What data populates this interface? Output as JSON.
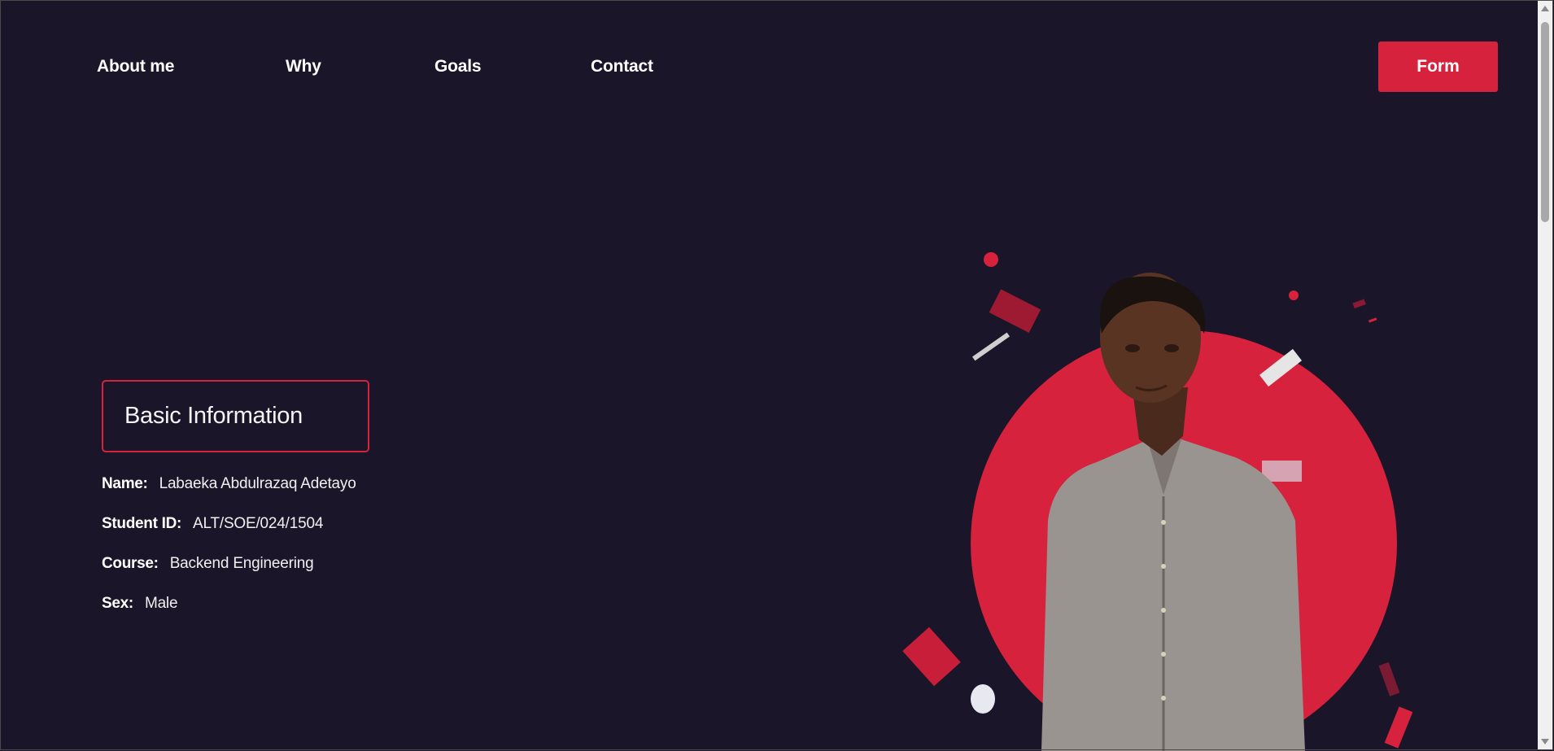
{
  "nav": {
    "links": [
      {
        "label": "About me"
      },
      {
        "label": "Why"
      },
      {
        "label": "Goals"
      },
      {
        "label": "Contact"
      }
    ],
    "form_button": "Form"
  },
  "basic_info": {
    "title": "Basic Information",
    "rows": [
      {
        "label": "Name:",
        "value": "Labaeka Abdulrazaq Adetayo"
      },
      {
        "label": "Student ID:",
        "value": "ALT/SOE/024/1504"
      },
      {
        "label": "Course:",
        "value": "Backend Engineering"
      },
      {
        "label": "Sex:",
        "value": "Male"
      }
    ]
  },
  "colors": {
    "background": "#1a1528",
    "accent": "#d7223d",
    "text": "#ffffff"
  }
}
